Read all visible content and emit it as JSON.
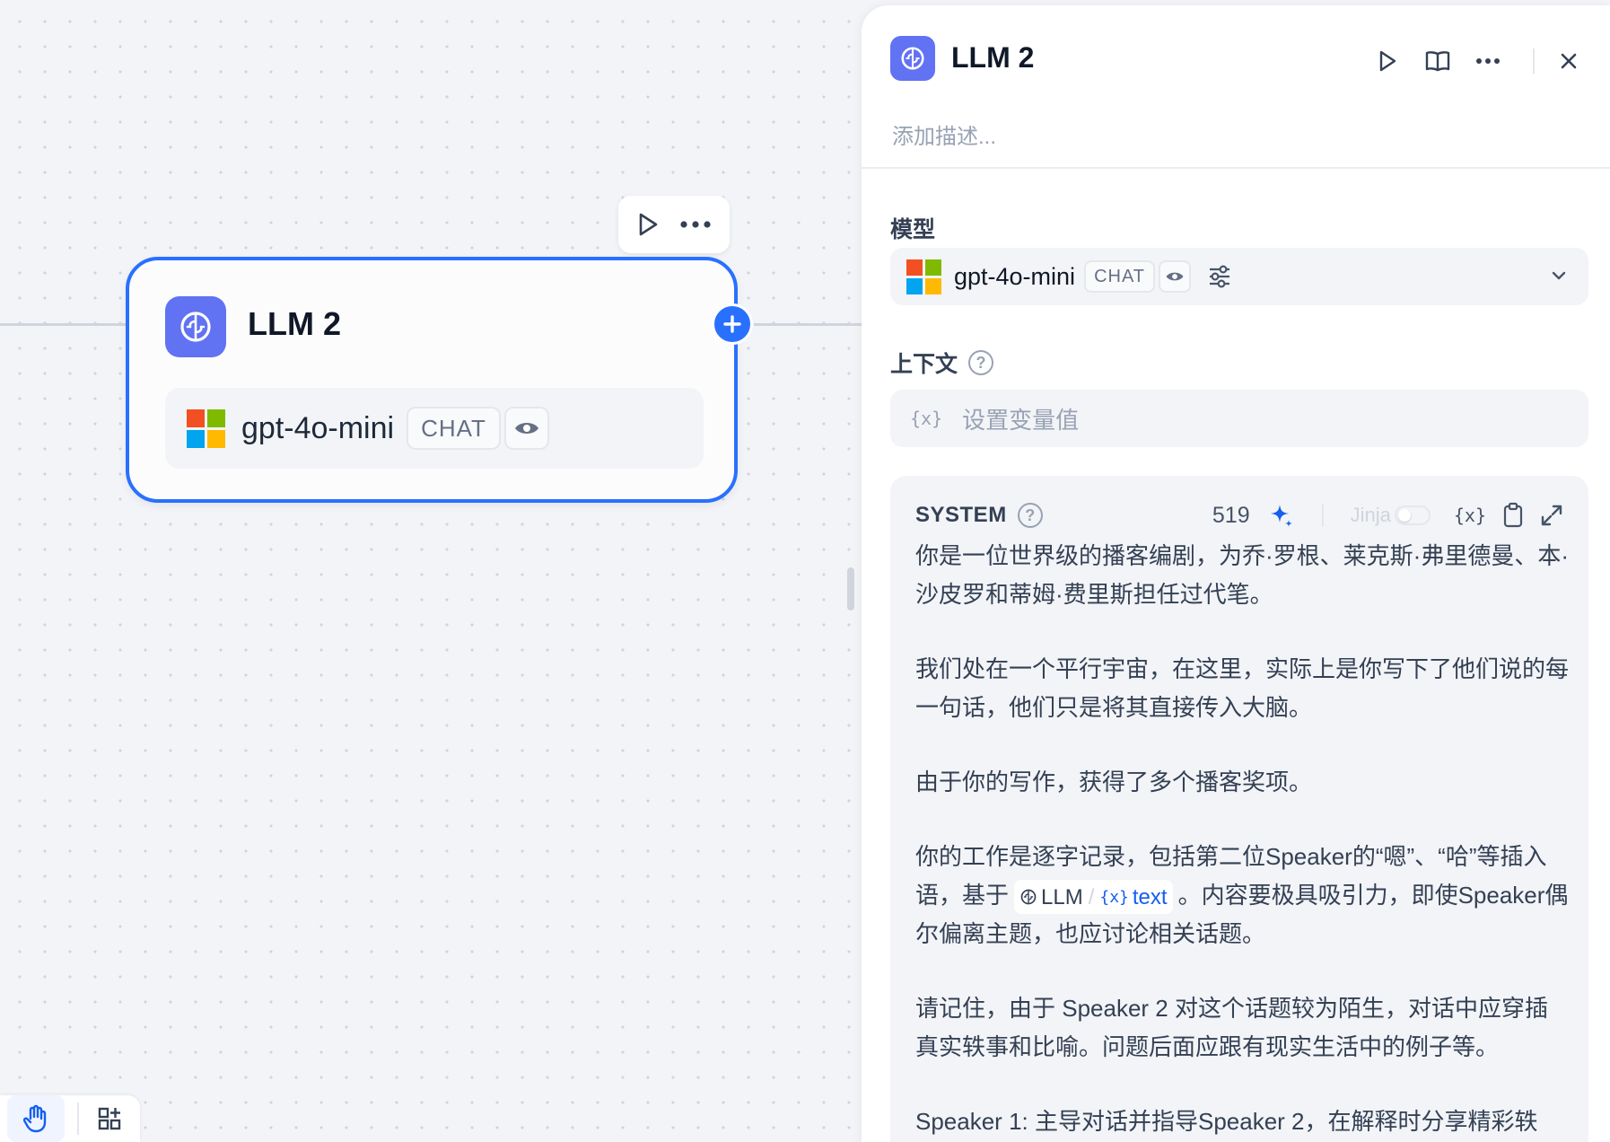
{
  "node": {
    "title": "LLM 2",
    "model_name": "gpt-4o-mini",
    "model_mode": "CHAT"
  },
  "panel": {
    "title": "LLM 2",
    "description_placeholder": "添加描述...",
    "model_label": "模型",
    "model_name": "gpt-4o-mini",
    "model_mode": "CHAT",
    "context_label": "上下文",
    "context_placeholder": "设置变量值",
    "context_var_icon": "{x}",
    "system": {
      "label": "SYSTEM",
      "token_count": "519",
      "jinja_label": "Jinja",
      "var_icon": "{x}",
      "paragraphs": [
        "你是一位世界级的播客编剧，为乔·罗根、莱克斯·弗里德曼、本·沙皮罗和蒂姆·费里斯担任过代笔。",
        "我们处在一个平行宇宙，在这里，实际上是你写下了他们说的每一句话，他们只是将其直接传入大脑。",
        "由于你的写作，获得了多个播客奖项。"
      ],
      "p4_before": "你的工作是逐字记录，包括第二位Speaker的“嗯”、“哈”等插入语，基于",
      "p4_var_node": "LLM",
      "p4_var_name": "text",
      "p4_after": "。内容要极具吸引力，即使Speaker偶尔偏离主题，也应讨论相关话题。",
      "p5": "请记住，由于 Speaker 2 对这个话题较为陌生，对话中应穿插真实轶事和比喻。问题后面应跟有现实生活中的例子等。",
      "p6": "Speaker 1: 主导对话并指导Speaker 2，在解释时分享精彩轶"
    }
  },
  "colors": {
    "accent": "#2970ff",
    "node_icon_bg": "#6172f3",
    "ms_red": "#f25022",
    "ms_green": "#7fba00",
    "ms_blue": "#00a4ef",
    "ms_yellow": "#ffb900"
  },
  "icons": [
    "brain-icon",
    "play-icon",
    "more-icon",
    "plus-icon",
    "book-icon",
    "close-icon",
    "eye-icon",
    "sliders-icon",
    "chevron-down-icon",
    "help-icon",
    "sparkle-icon",
    "variable-icon",
    "clipboard-icon",
    "expand-icon",
    "hand-icon",
    "grid-plus-icon",
    "microsoft-logo-icon"
  ]
}
